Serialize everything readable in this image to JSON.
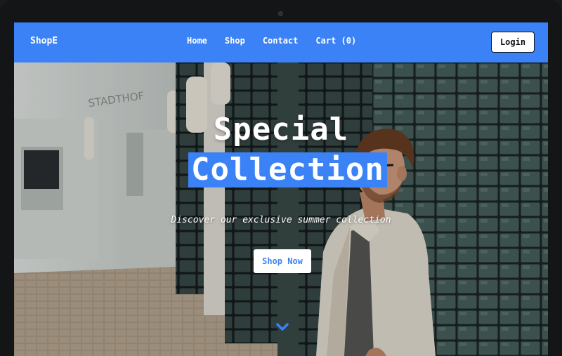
{
  "navbar": {
    "brand": "ShopE",
    "links": [
      "Home",
      "Shop",
      "Contact",
      "Cart (0)"
    ],
    "login_label": "Login",
    "color": "#3b82f6"
  },
  "hero": {
    "title_line1": "Special",
    "title_line2": "Collection",
    "subtitle": "Discover our exclusive summer collection",
    "cta_label": "Shop Now",
    "accent": "#3b82f6",
    "scroll_icon": "chevron-down-icon",
    "background_image": "man-in-glasses-leaning-on-tiled-wall"
  }
}
